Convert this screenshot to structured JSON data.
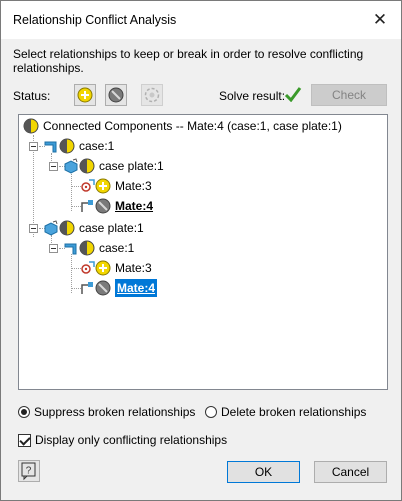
{
  "window": {
    "title": "Relationship Conflict Analysis",
    "close_glyph": "✕"
  },
  "instructions": "Select relationships to keep or break in order to resolve conflicting relationships.",
  "status": {
    "label": "Status:",
    "buttons": [
      {
        "icon": "keep-relationship-icon",
        "color": "#f2d600"
      },
      {
        "icon": "break-relationship-icon",
        "color": "#7a7a7a"
      },
      {
        "icon": "resolve-disabled-icon",
        "color": "#b0b0b0"
      }
    ]
  },
  "solve": {
    "label": "Solve result:",
    "result_icon": "green-check-icon",
    "result_color": "#3a9a2a",
    "check_label": "Check"
  },
  "tree": {
    "root": "Connected Components -- Mate:4 (case:1, case plate:1)",
    "nodes": [
      {
        "label": "case:1",
        "level": 1,
        "status": "half"
      },
      {
        "label": "case plate:1",
        "level": 2,
        "status": "half"
      },
      {
        "label": "Mate:3",
        "level": 3,
        "status": "keep"
      },
      {
        "label": "Mate:4",
        "level": 3,
        "status": "broken",
        "bold": true
      },
      {
        "label": "case plate:1",
        "level": 1,
        "status": "half"
      },
      {
        "label": "case:1",
        "level": 2,
        "status": "half"
      },
      {
        "label": "Mate:3",
        "level": 3,
        "status": "keep"
      },
      {
        "label": "Mate:4",
        "level": 3,
        "status": "broken",
        "bold": true,
        "selected": true
      }
    ]
  },
  "options": {
    "suppress_label": "Suppress broken relationships",
    "suppress_selected": true,
    "delete_label": "Delete broken relationships",
    "delete_selected": false,
    "display_only_label": "Display only conflicting relationships",
    "display_only_checked": true
  },
  "footer": {
    "help_glyph": "?",
    "ok_label": "OK",
    "cancel_label": "Cancel"
  },
  "colors": {
    "accent": "#0078d7",
    "keep": "#f2d600",
    "broken": "#7a7a7a"
  }
}
